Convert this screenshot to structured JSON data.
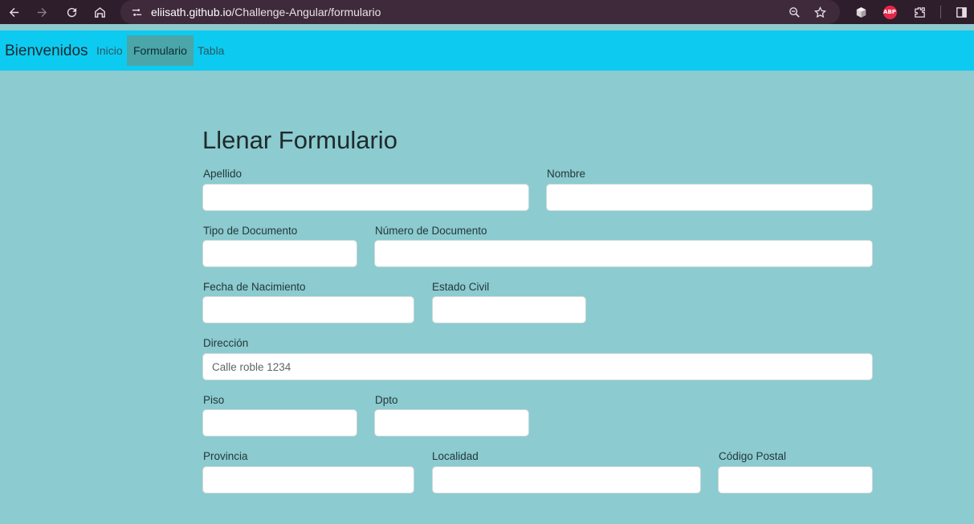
{
  "browser": {
    "url_host": "eliisath.github.io",
    "url_path": "/Challenge-Angular/formulario",
    "extension_abp_label": "ABP"
  },
  "navbar": {
    "brand": "Bienvenidos",
    "links": [
      {
        "label": "Inicio",
        "active": false
      },
      {
        "label": "Formulario",
        "active": true
      },
      {
        "label": "Tabla",
        "active": false
      }
    ],
    "bg_color": "#0dcaf0"
  },
  "form": {
    "title": "Llenar Formulario",
    "fields": {
      "apellido": {
        "label": "Apellido",
        "value": "",
        "placeholder": ""
      },
      "nombre": {
        "label": "Nombre",
        "value": "",
        "placeholder": ""
      },
      "tipo_documento": {
        "label": "Tipo de Documento",
        "value": "",
        "placeholder": ""
      },
      "numero_documento": {
        "label": "Número de Documento",
        "value": "",
        "placeholder": ""
      },
      "fecha_nacimiento": {
        "label": "Fecha de Nacimiento",
        "value": "",
        "placeholder": ""
      },
      "estado_civil": {
        "label": "Estado Civil",
        "value": "",
        "placeholder": ""
      },
      "direccion": {
        "label": "Dirección",
        "value": "",
        "placeholder": "Calle roble 1234"
      },
      "piso": {
        "label": "Piso",
        "value": "",
        "placeholder": ""
      },
      "dpto": {
        "label": "Dpto",
        "value": "",
        "placeholder": ""
      },
      "provincia": {
        "label": "Provincia",
        "value": "",
        "placeholder": ""
      },
      "localidad": {
        "label": "Localidad",
        "value": "",
        "placeholder": ""
      },
      "codigo_postal": {
        "label": "Código Postal",
        "value": "",
        "placeholder": ""
      }
    },
    "bg_color": "#8ccbcf"
  }
}
